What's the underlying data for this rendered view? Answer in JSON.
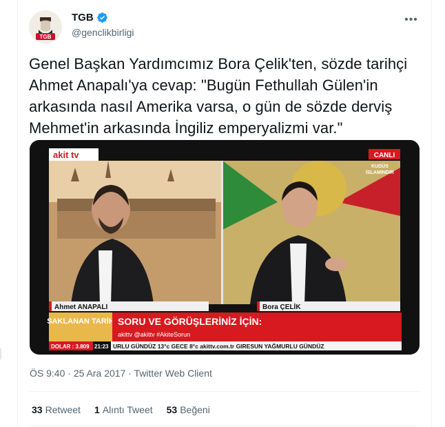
{
  "author": {
    "name": "TGB",
    "handle": "@genclikbirligi",
    "avatar_text": "TGB",
    "verified_icon": "verified-badge-icon"
  },
  "more_icon": "more-dots-icon",
  "tweet": {
    "text": "Genel Başkan Yardımcımız Bora Çelik'ten, sözde tarihçi Ahmet Anapalı'ya cevap: \"Bugün Fethullah Gülen'in arkasında nasıl Amerika varsa, o gün de sözde derviş Mehmet'in arkasında İngiliz emperyalizmi var.\""
  },
  "media": {
    "channel_logo": "akit tv",
    "live_badge": "CANLI",
    "corner_text_1": "KUDÜS",
    "corner_text_2": "İSLAMINDIR",
    "left_name": "Ahmet ANAPALI",
    "right_name": "Bora ÇELİK",
    "program": "SAKLANAN TARİH",
    "banner_title": "SORU VE GÖRÜŞLERİNİZ İÇİN:",
    "banner_social": "akittv  @akittv  #AkiteSorun",
    "dollar": "DOLAR : 3.809",
    "clock": "21:23",
    "ticker": "URLU  GÜNDÜZ  13°c  GECE  8°c  akittv.com.tr  GIRESUN  YAĞMURLU  GÜNDÜZ"
  },
  "meta": {
    "time": "ÖS 9:40",
    "date": "25 Ara 2017",
    "client": "Twitter Web Client",
    "separator": "·"
  },
  "stats": [
    {
      "count": "33",
      "label": "Retweet"
    },
    {
      "count": "1",
      "label": "Alıntı Tweet"
    },
    {
      "count": "53",
      "label": "Beğeni"
    }
  ],
  "colors": {
    "accent_blue": "#1d9bf0",
    "secondary_text": "#536471",
    "akit_red": "#d71920"
  }
}
